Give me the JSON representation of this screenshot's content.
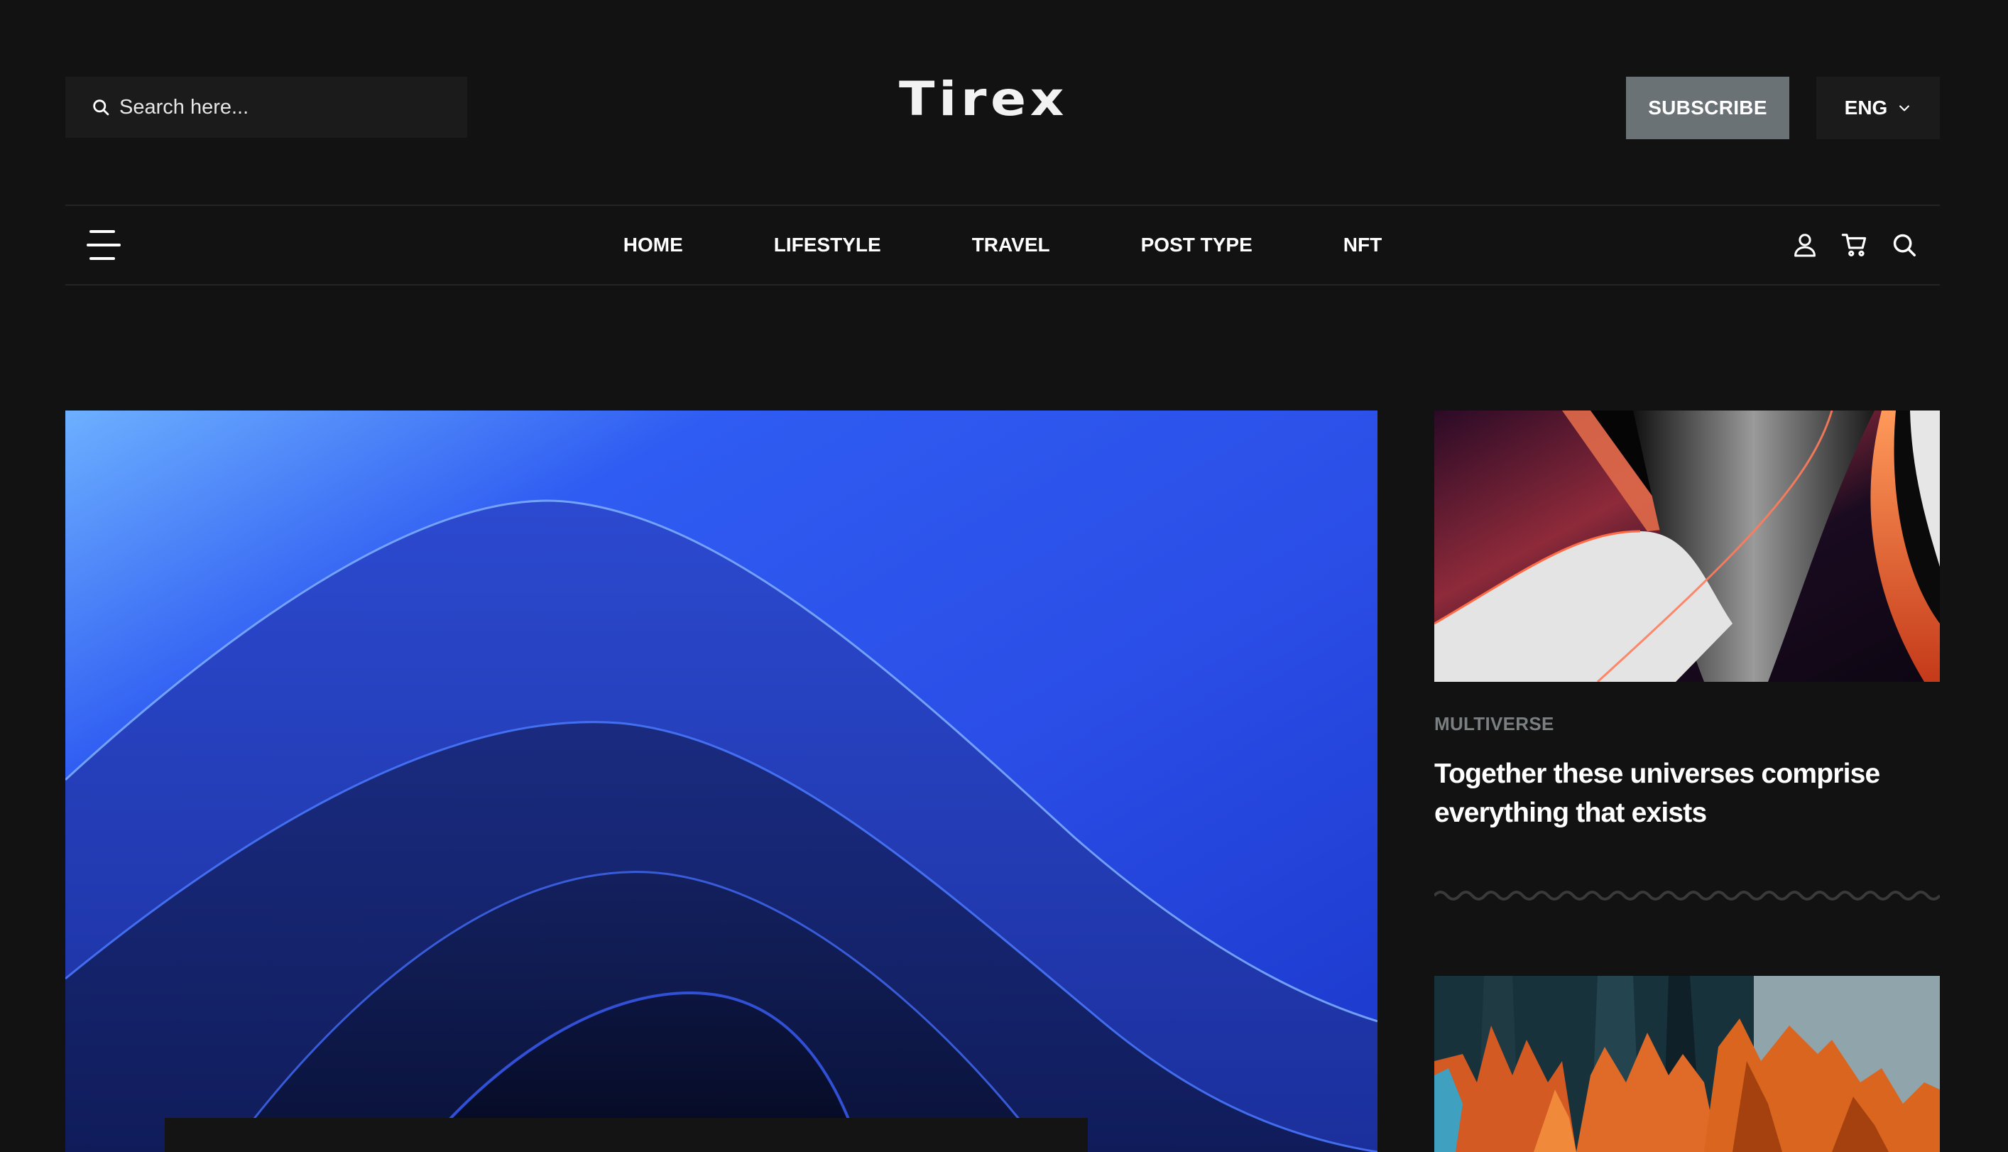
{
  "header": {
    "search_placeholder": "Search here...",
    "logo_text": "Tirex",
    "subscribe_label": "SUBSCRIBE",
    "language_selected": "ENG"
  },
  "nav": {
    "items": [
      {
        "label": "HOME"
      },
      {
        "label": "LIFESTYLE"
      },
      {
        "label": "TRAVEL"
      },
      {
        "label": "POST TYPE"
      },
      {
        "label": "NFT"
      }
    ],
    "icons": [
      "menu-icon",
      "user-icon",
      "cart-icon",
      "search-icon"
    ]
  },
  "sidebar": {
    "posts": [
      {
        "category": "MULTIVERSE",
        "title": "Together these universes comprise everything that exists"
      }
    ]
  },
  "colors": {
    "background": "#121212",
    "input_bg": "#1b1b1b",
    "subscribe_bg": "#6b7275",
    "category_text": "#7a7f82",
    "text": "#ffffff",
    "divider": "#242424"
  }
}
